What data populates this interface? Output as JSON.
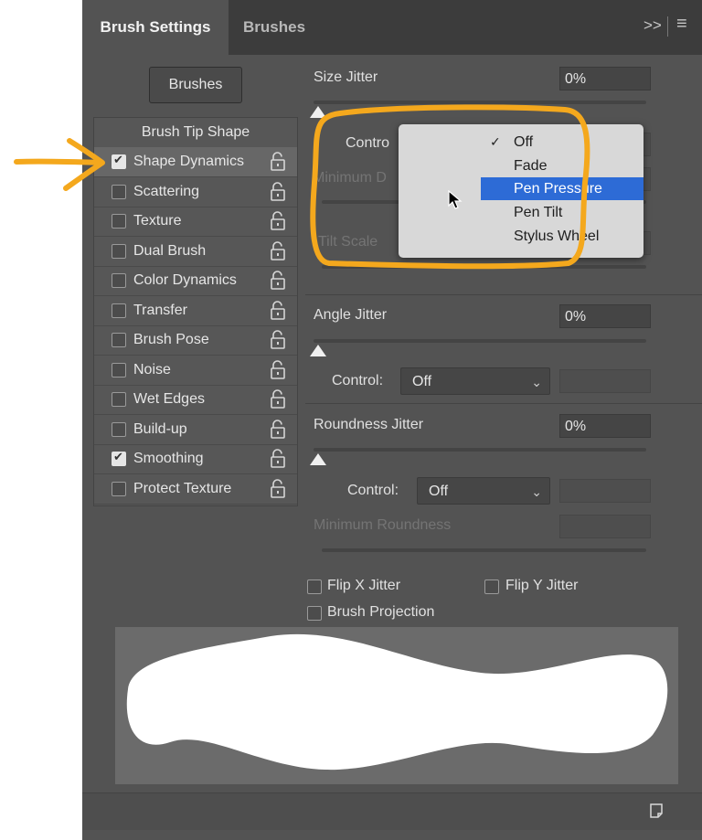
{
  "tabs": {
    "active": "Brush Settings",
    "inactive": "Brushes"
  },
  "toolbar": {
    "collapse_label": ">>",
    "menu_label": "≡"
  },
  "brushes_button": "Brushes",
  "leftlist": {
    "header": "Brush Tip Shape",
    "items": [
      {
        "label": "Shape Dynamics",
        "checked": true
      },
      {
        "label": "Scattering",
        "checked": false
      },
      {
        "label": "Texture",
        "checked": false
      },
      {
        "label": "Dual Brush",
        "checked": false
      },
      {
        "label": "Color Dynamics",
        "checked": false
      },
      {
        "label": "Transfer",
        "checked": false
      },
      {
        "label": "Brush Pose",
        "checked": false
      },
      {
        "label": "Noise",
        "checked": false
      },
      {
        "label": "Wet Edges",
        "checked": false
      },
      {
        "label": "Build-up",
        "checked": false
      },
      {
        "label": "Smoothing",
        "checked": true
      },
      {
        "label": "Protect Texture",
        "checked": false
      }
    ]
  },
  "size_jitter": {
    "label": "Size Jitter",
    "value": "0%"
  },
  "partial": {
    "control": "Contro",
    "minimum_diameter": "Minimum D",
    "tilt_scale": "Tilt Scale"
  },
  "dropdown": {
    "options": [
      "Off",
      "Fade",
      "Pen Pressure",
      "Pen Tilt",
      "Stylus Wheel"
    ],
    "checked": "Off",
    "highlighted": "Pen Pressure",
    "checkmark": "✓"
  },
  "angle_jitter": {
    "label": "Angle Jitter",
    "value": "0%",
    "control_label": "Control:",
    "control_value": "Off"
  },
  "roundness_jitter": {
    "label": "Roundness Jitter",
    "value": "0%",
    "control_label": "Control:",
    "control_value": "Off",
    "min_label": "Minimum Roundness"
  },
  "checkboxes": {
    "flip_x": "Flip X Jitter",
    "flip_y": "Flip Y Jitter",
    "projection": "Brush Projection"
  },
  "colors": {
    "annotation": "#f4a81d",
    "highlight": "#2d6bd6",
    "panel": "#535353"
  }
}
